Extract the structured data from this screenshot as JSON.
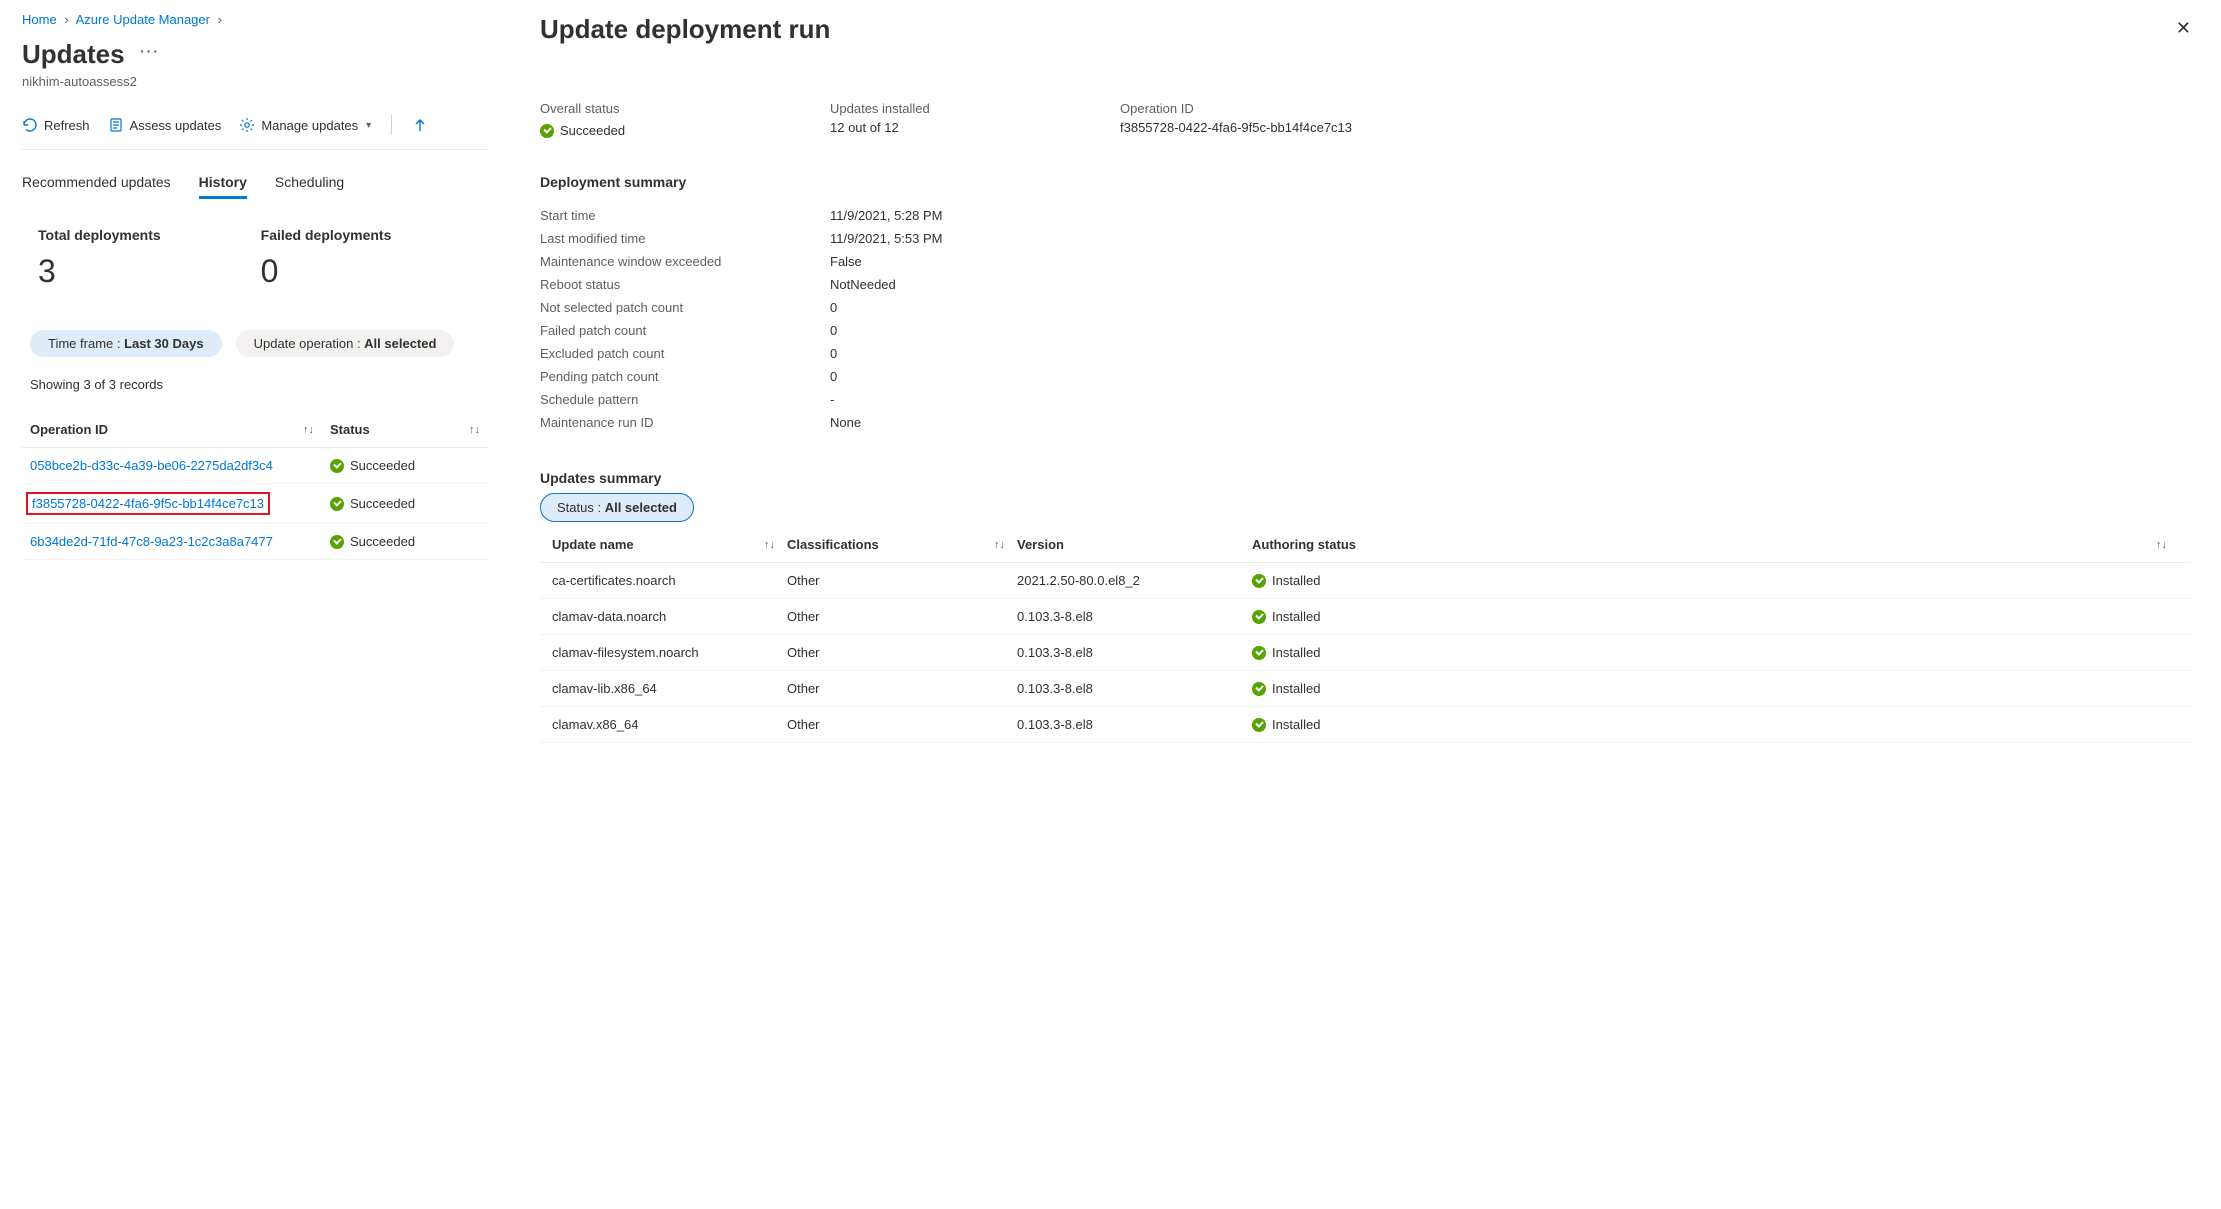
{
  "breadcrumb": {
    "home": "Home",
    "aum": "Azure Update Manager"
  },
  "page": {
    "title": "Updates",
    "subtitle": "nikhim-autoassess2"
  },
  "toolbar": {
    "refresh": "Refresh",
    "assess": "Assess updates",
    "manage": "Manage updates"
  },
  "tabs": {
    "recommended": "Recommended updates",
    "history": "History",
    "scheduling": "Scheduling"
  },
  "stats": {
    "total_label": "Total deployments",
    "total_value": "3",
    "failed_label": "Failed deployments",
    "failed_value": "0"
  },
  "filters": {
    "timeframe_label": "Time frame : ",
    "timeframe_value": "Last 30 Days",
    "updateop_label": "Update operation : ",
    "updateop_value": "All selected"
  },
  "records_text": "Showing 3 of 3 records",
  "op_table": {
    "col_op": "Operation ID",
    "col_status": "Status",
    "rows": [
      {
        "id": "058bce2b-d33c-4a39-be06-2275da2df3c4",
        "status": "Succeeded",
        "highlight": false
      },
      {
        "id": "f3855728-0422-4fa6-9f5c-bb14f4ce7c13",
        "status": "Succeeded",
        "highlight": true
      },
      {
        "id": "6b34de2d-71fd-47c8-9a23-1c2c3a8a7477",
        "status": "Succeeded",
        "highlight": false
      }
    ]
  },
  "panel": {
    "title": "Update deployment run",
    "overall_label": "Overall status",
    "overall_value": "Succeeded",
    "installed_label": "Updates installed",
    "installed_value": "12 out of 12",
    "opid_label": "Operation ID",
    "opid_value": "f3855728-0422-4fa6-9f5c-bb14f4ce7c13"
  },
  "summary": {
    "heading": "Deployment summary",
    "items": [
      {
        "k": "Start time",
        "v": "11/9/2021, 5:28 PM"
      },
      {
        "k": "Last modified time",
        "v": "11/9/2021, 5:53 PM"
      },
      {
        "k": "Maintenance window exceeded",
        "v": "False"
      },
      {
        "k": "Reboot status",
        "v": "NotNeeded"
      },
      {
        "k": "Not selected patch count",
        "v": "0"
      },
      {
        "k": "Failed patch count",
        "v": "0"
      },
      {
        "k": "Excluded patch count",
        "v": "0"
      },
      {
        "k": "Pending patch count",
        "v": "0"
      },
      {
        "k": "Schedule pattern",
        "v": "-"
      },
      {
        "k": "Maintenance run ID",
        "v": "None"
      }
    ]
  },
  "updates_summary": {
    "heading": "Updates summary",
    "status_pill_label": "Status : ",
    "status_pill_value": "All selected",
    "cols": {
      "name": "Update name",
      "class": "Classifications",
      "version": "Version",
      "auth": "Authoring status"
    },
    "rows": [
      {
        "name": "ca-certificates.noarch",
        "class": "Other",
        "version": "2021.2.50-80.0.el8_2",
        "auth": "Installed"
      },
      {
        "name": "clamav-data.noarch",
        "class": "Other",
        "version": "0.103.3-8.el8",
        "auth": "Installed"
      },
      {
        "name": "clamav-filesystem.noarch",
        "class": "Other",
        "version": "0.103.3-8.el8",
        "auth": "Installed"
      },
      {
        "name": "clamav-lib.x86_64",
        "class": "Other",
        "version": "0.103.3-8.el8",
        "auth": "Installed"
      },
      {
        "name": "clamav.x86_64",
        "class": "Other",
        "version": "0.103.3-8.el8",
        "auth": "Installed"
      }
    ]
  }
}
